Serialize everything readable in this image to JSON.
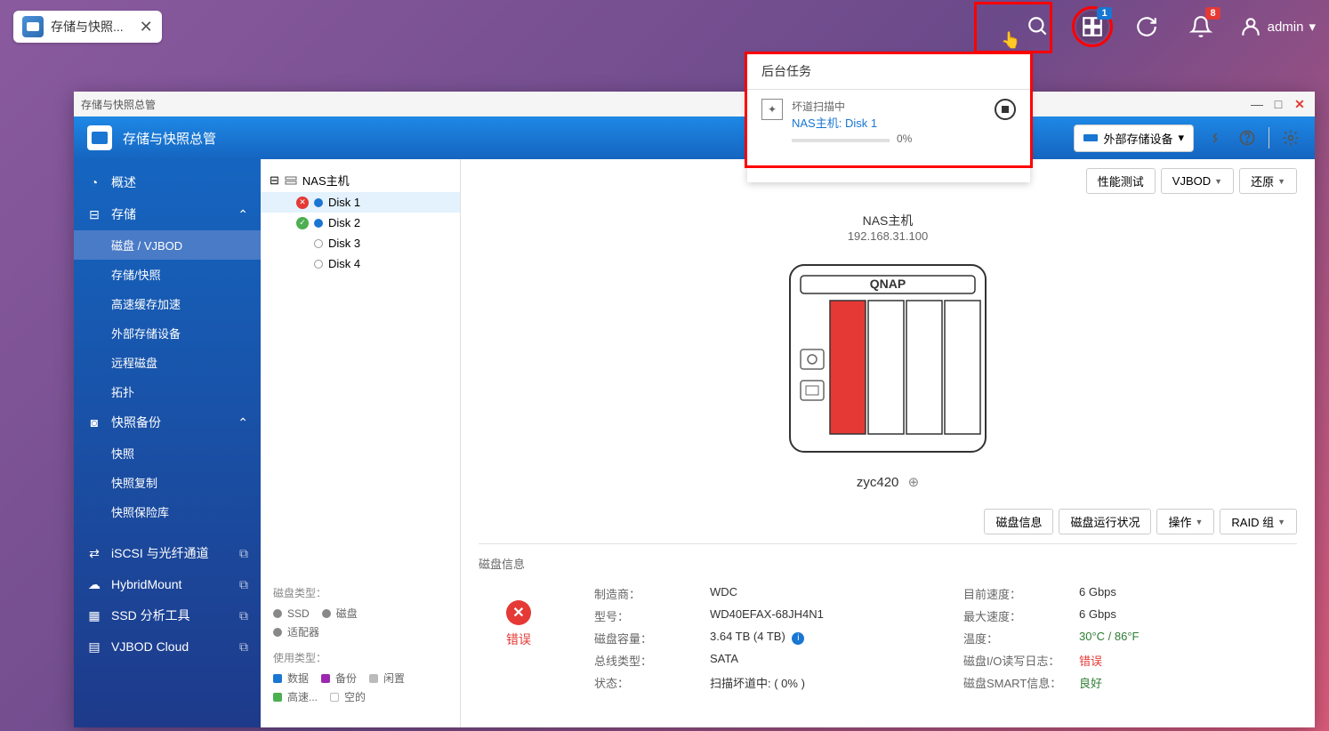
{
  "taskbar": {
    "app_title": "存储与快照...",
    "dashboard_badge": "1",
    "notification_badge": "8",
    "username": "admin"
  },
  "bg_task": {
    "header": "后台任务",
    "task_type": "坏道扫描中",
    "task_target": "NAS主机: Disk 1",
    "progress": "0%"
  },
  "window": {
    "titlebar": "存储与快照总管",
    "header_title": "存储与快照总管",
    "ext_storage_btn": "外部存储设备"
  },
  "sidebar": {
    "overview": "概述",
    "storage": "存储",
    "disk_vjbod": "磁盘 / VJBOD",
    "storage_snapshot": "存储/快照",
    "cache_accel": "高速缓存加速",
    "ext_storage": "外部存储设备",
    "remote_disk": "远程磁盘",
    "topology": "拓扑",
    "snapshot_backup": "快照备份",
    "snapshot": "快照",
    "snapshot_copy": "快照复制",
    "snapshot_vault": "快照保险库",
    "iscsi": "iSCSI 与光纤通道",
    "hybridmount": "HybridMount",
    "ssd_tool": "SSD 分析工具",
    "vjbod_cloud": "VJBOD Cloud"
  },
  "tree": {
    "root": "NAS主机",
    "disk1": "Disk 1",
    "disk2": "Disk 2",
    "disk3": "Disk 3",
    "disk4": "Disk 4"
  },
  "legend": {
    "disk_type_title": "磁盘类型：",
    "ssd": "SSD",
    "disk": "磁盘",
    "adapter": "适配器",
    "usage_title": "使用类型：",
    "data": "数据",
    "backup": "备份",
    "idle": "闲置",
    "cache": "高速...",
    "empty": "空的"
  },
  "actions": {
    "perf_test": "性能测试",
    "vjbod": "VJBOD",
    "restore": "还原",
    "disk_info": "磁盘信息",
    "disk_status": "磁盘运行状况",
    "operation": "操作",
    "raid_group": "RAID 组"
  },
  "nas": {
    "title": "NAS主机",
    "ip": "192.168.31.100",
    "brand": "QNAP",
    "model": "zyc420"
  },
  "disk_info": {
    "section_title": "磁盘信息",
    "status": "错误",
    "manufacturer_label": "制造商：",
    "manufacturer": "WDC",
    "model_label": "型号：",
    "model": "WD40EFAX-68JH4N1",
    "capacity_label": "磁盘容量：",
    "capacity": "3.64 TB (4 TB)",
    "bus_label": "总线类型：",
    "bus": "SATA",
    "state_label": "状态：",
    "state": "扫描坏道中: ( 0% )",
    "cur_speed_label": "目前速度：",
    "cur_speed": "6 Gbps",
    "max_speed_label": "最大速度：",
    "max_speed": "6 Gbps",
    "temp_label": "温度：",
    "temp": "30°C / 86°F",
    "io_log_label": "磁盘I/O读写日志：",
    "io_log": "错误",
    "smart_label": "磁盘SMART信息：",
    "smart": "良好"
  }
}
